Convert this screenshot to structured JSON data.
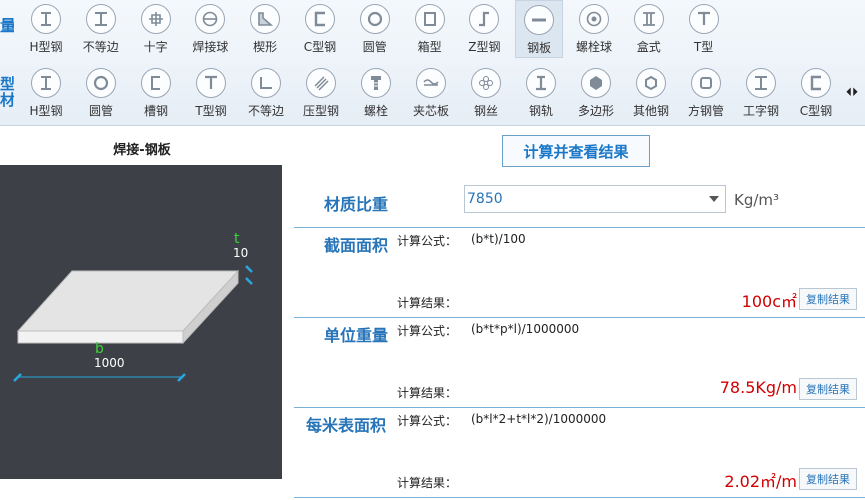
{
  "toolbar": {
    "side_label_top": "量",
    "side_label_bottom": "型材",
    "row1": [
      {
        "label": "H型钢",
        "icon": "h-beam-icon"
      },
      {
        "label": "不等边",
        "icon": "i-beam-icon"
      },
      {
        "label": "十字",
        "icon": "cross-icon"
      },
      {
        "label": "焊接球",
        "icon": "welded-ball-icon"
      },
      {
        "label": "楔形",
        "icon": "wedge-icon"
      },
      {
        "label": "C型钢",
        "icon": "c-channel-icon"
      },
      {
        "label": "圆管",
        "icon": "round-tube-icon"
      },
      {
        "label": "箱型",
        "icon": "box-section-icon"
      },
      {
        "label": "Z型钢",
        "icon": "z-section-icon"
      },
      {
        "label": "钢板",
        "icon": "plate-icon",
        "active": true
      },
      {
        "label": "螺栓球",
        "icon": "bolt-ball-icon"
      },
      {
        "label": "盒式",
        "icon": "box-type-icon"
      },
      {
        "label": "T型",
        "icon": "t-section-icon"
      }
    ],
    "row2": [
      {
        "label": "H型钢",
        "icon": "h-beam-icon"
      },
      {
        "label": "圆管",
        "icon": "round-tube-icon"
      },
      {
        "label": "槽钢",
        "icon": "channel-icon"
      },
      {
        "label": "T型钢",
        "icon": "t-section-icon"
      },
      {
        "label": "不等边",
        "icon": "angle-icon"
      },
      {
        "label": "压型钢",
        "icon": "profiled-sheet-icon"
      },
      {
        "label": "螺栓",
        "icon": "bolt-icon"
      },
      {
        "label": "夹芯板",
        "icon": "sandwich-panel-icon"
      },
      {
        "label": "钢丝",
        "icon": "steel-wire-icon"
      },
      {
        "label": "钢轨",
        "icon": "rail-icon"
      },
      {
        "label": "多边形",
        "icon": "polygon-icon"
      },
      {
        "label": "其他钢",
        "icon": "other-steel-icon"
      },
      {
        "label": "方钢管",
        "icon": "square-tube-icon"
      },
      {
        "label": "工字钢",
        "icon": "i-beam-icon"
      },
      {
        "label": "C型钢",
        "icon": "c-channel-icon"
      }
    ],
    "scroll_arrows": "⏴⏵"
  },
  "left": {
    "title": "焊接-钢板",
    "dim_t_label": "t",
    "dim_t_value": "10",
    "dim_b_label": "b",
    "dim_b_value": "1000"
  },
  "right": {
    "calc_button": "计算并查看结果",
    "density_label": "材质比重",
    "density_value": "7850",
    "density_unit": "Kg/m³",
    "sections": [
      {
        "name": "截面面积",
        "formula_label": "计算公式：",
        "formula": "(b*t)/100",
        "result_label": "计算结果：",
        "result": "100c㎡",
        "copy": "复制结果"
      },
      {
        "name": "单位重量",
        "formula_label": "计算公式：",
        "formula": "(b*t*p*l)/1000000",
        "result_label": "计算结果：",
        "result": "78.5Kg/m",
        "copy": "复制结果"
      },
      {
        "name": "每米表面积",
        "formula_label": "计算公式：",
        "formula": "(b*l*2+t*l*2)/1000000",
        "result_label": "计算结果：",
        "result": "2.02㎡/m",
        "copy": "复制结果"
      }
    ]
  },
  "colors": {
    "accent": "#2774b8",
    "result": "#d10000",
    "canvas": "#3d4147",
    "dim_green": "#3fd13f",
    "dim_cyan": "#29a8e0"
  }
}
